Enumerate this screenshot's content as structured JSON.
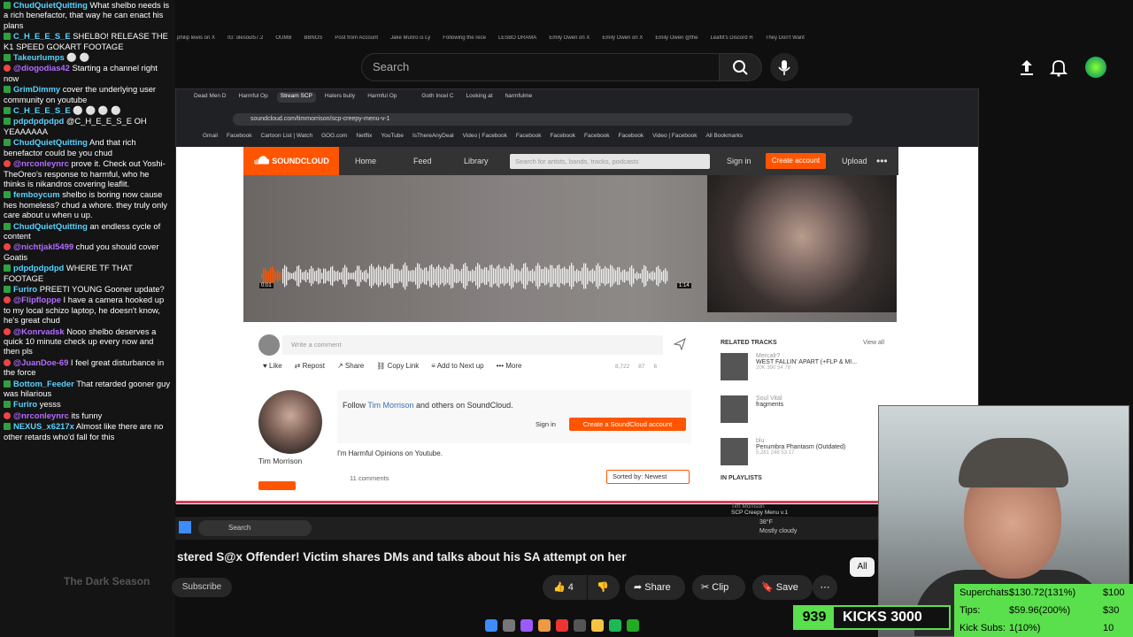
{
  "youtube": {
    "search_placeholder": "Search",
    "video_title": "Harmful Opinions A Registered S@x Offender! Victim shares DMs and talks about his SA attempt on her",
    "title_visible": "stered S@x Offender! Victim shares DMs and talks about his SA attempt on her",
    "channel": "The Dark Season",
    "subscribe": "Subscribe",
    "likes": "4",
    "share": "Share",
    "clip": "Clip",
    "save": "Save",
    "chip_all": "All"
  },
  "chat": [
    {
      "user": "ChudQuietQuitting",
      "text": "What shelbo needs is a rich benefactor, that way he can enact his plans",
      "badge": "check",
      "color": "#59d3ff"
    },
    {
      "user": "C_H_E_E_S_E",
      "text": "SHELBO! RELEASE THE K1 SPEED GOKART FOOTAGE",
      "badge": "check",
      "color": "#59d3ff"
    },
    {
      "user": "Takeurlumps",
      "text": "⚪ ⚪",
      "badge": "check",
      "color": "#59d3ff"
    },
    {
      "user": "@diogodias42",
      "text": "Starting a channel right now",
      "badge": "red",
      "color": "#b36cff"
    },
    {
      "user": "GrimDimmy",
      "text": "cover the underlying user community on youtube",
      "badge": "check",
      "color": "#59d3ff"
    },
    {
      "user": "C_H_E_E_S_E",
      "text": "⚪ ⚪ ⚪ ⚪",
      "badge": "check",
      "color": "#59d3ff"
    },
    {
      "user": "pdpdpdpdpd",
      "text": "@C_H_E_E_S_E OH YEAAAAAA",
      "badge": "check",
      "color": "#59d3ff"
    },
    {
      "user": "ChudQuietQuitting",
      "text": "And that rich benefactor could be you chud",
      "badge": "check",
      "color": "#59d3ff"
    },
    {
      "user": "@nrconleynrc",
      "text": "prove it. Check out Yoshi-TheOreo's response to harmful, who he thinks is nikandros covering leaflit.",
      "badge": "red",
      "color": "#b36cff"
    },
    {
      "user": "femboycum",
      "text": "shelbo is boring now cause hes homeless? chud a whore. they truly only care about u when u up.",
      "badge": "check",
      "color": "#59d3ff"
    },
    {
      "user": "ChudQuietQuitting",
      "text": "an endless cycle of content",
      "badge": "check",
      "color": "#59d3ff"
    },
    {
      "user": "@nichtjakl5499",
      "text": "chud you should cover Goatis",
      "badge": "red",
      "color": "#b36cff"
    },
    {
      "user": "pdpdpdpdpd",
      "text": "WHERE TF THAT FOOTAGE",
      "badge": "check",
      "color": "#59d3ff"
    },
    {
      "user": "Furiro",
      "text": "PREETI YOUNG Gooner update?",
      "badge": "check",
      "color": "#59d3ff"
    },
    {
      "user": "@Flipfloppe",
      "text": "I have a camera hooked up to my local schizo laptop, he doesn't know, he's great chud",
      "badge": "red",
      "color": "#b36cff"
    },
    {
      "user": "@Konrvadsk",
      "text": "Nooo shelbo deserves a quick 10 minute check up every now and then pls",
      "badge": "red",
      "color": "#b36cff"
    },
    {
      "user": "@JuanDoe-69",
      "text": "I feel great disturbance in the force",
      "badge": "red",
      "color": "#b36cff"
    },
    {
      "user": "Bottom_Feeder",
      "text": "That retarded gooner guy was hilarious",
      "badge": "check",
      "color": "#59d3ff"
    },
    {
      "user": "Furiro",
      "text": "yesss",
      "badge": "check",
      "color": "#59d3ff"
    },
    {
      "user": "@nrconleynrc",
      "text": "its funny",
      "badge": "red",
      "color": "#b36cff"
    },
    {
      "user": "NEXUS_x6217x",
      "text": "Almost like there are no other retards who'd fall for this",
      "badge": "check",
      "color": "#59d3ff"
    }
  ],
  "browser": {
    "tabs": [
      "Dead Men D",
      "Harmful Op",
      "Stream SCP",
      "Haters bully",
      "Harmful Op",
      "",
      "Goth Incel C",
      "Looking at",
      "harmfulme"
    ],
    "url": "soundcloud.com/timmorrison/scp-creepy-menu-v-1",
    "bookmarks": [
      "Gmail",
      "Facebook",
      "Cartoon List | Watch",
      "GOG.com",
      "Netflix",
      "YouTube",
      "IsThereAnyDeal",
      "Video | Facebook",
      "Facebook",
      "Facebook",
      "Facebook",
      "Facebook",
      "Video | Facebook",
      "All Bookmarks"
    ],
    "top_tiny_tabs": [
      "philip lewis on X",
      "IG: olesoul57.2",
      "OUMB",
      "BBNOS",
      "Post from Account",
      "Jake Munro is Ly",
      "Following the rece",
      "LESBO DRAMA",
      "Emily Owen on X",
      "Emily Owen on X",
      "Emily Owen @the",
      "Leaflit's Discord R",
      "They Don't Want"
    ]
  },
  "soundcloud": {
    "logo": "SOUNDCLOUD",
    "nav": [
      "Home",
      "Feed",
      "Library"
    ],
    "search_placeholder": "Search for artists, bands, tracks, podcasts",
    "sign_in": "Sign in",
    "create_account": "Create account",
    "upload": "Upload",
    "comment_placeholder": "Write a comment",
    "actions": [
      "Like",
      "Repost",
      "Share",
      "Copy Link",
      "Add to Next up",
      "More"
    ],
    "stats": [
      "8,722",
      "87",
      "6"
    ],
    "artist": "Tim Morrison",
    "follow_text_pre": "Follow",
    "follow_text_post": "and others on SoundCloud.",
    "follow_signin": "Sign in",
    "follow_create": "Create a SoundCloud account",
    "bio": "I'm Harmful Opinions on Youtube.",
    "comments_count": "11 comments",
    "sort": "Sorted by: Newest",
    "related_title": "RELATED TRACKS",
    "view_all": "View all",
    "in_playlists": "IN PLAYLISTS",
    "related": [
      {
        "artist": "Mercalr?",
        "title": "WEST FALLIN' APART (+FLP & MI...",
        "meta": "20K  390  54  78"
      },
      {
        "artist": "Soul Vital",
        "title": "fragments",
        "meta": ""
      },
      {
        "artist": "blu",
        "title": "Penumbra Phantasm (Outdated)",
        "meta": "5,261  248  53  17"
      }
    ],
    "player_track": "SCP Creepy Menu v.1",
    "player_artist": "Tim Morrison",
    "time_start": "0:01",
    "time_end": "1:14"
  },
  "taskbar": {
    "search": "Search",
    "weather": "38°F",
    "weather_desc": "Mostly cloudy"
  },
  "stream": {
    "kicks_count": "939",
    "kicks_label": "KICKS",
    "kicks_goal": "3000",
    "superchats_label": "Superchats:",
    "superchats_value": "$130.72(131%)",
    "superchats_goal": "$100",
    "tips_label": "Tips:",
    "tips_value": "$59.96(200%)",
    "tips_goal": "$30",
    "kick_subs_label": "Kick Subs:",
    "kick_subs_value": "1(10%)",
    "kick_subs_goal": "10"
  },
  "colors": {
    "accent_orange": "#ff5500",
    "kick_green": "#5be04d",
    "yt_red": "#e0395a"
  }
}
